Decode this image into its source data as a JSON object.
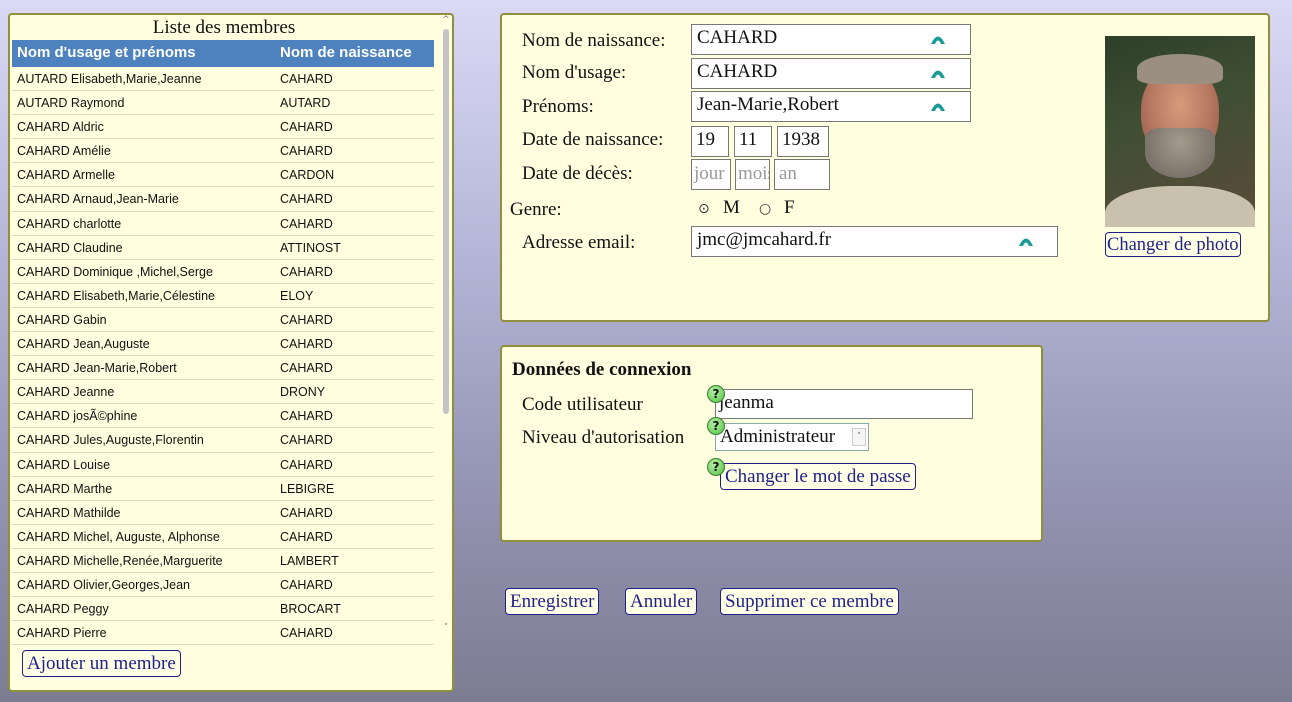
{
  "members_list": {
    "title": "Liste des membres",
    "columns": [
      "Nom d'usage et prénoms",
      "Nom de naissance"
    ],
    "rows": [
      [
        "AUTARD Elisabeth,Marie,Jeanne",
        "CAHARD"
      ],
      [
        "AUTARD Raymond",
        "AUTARD"
      ],
      [
        "CAHARD Aldric",
        "CAHARD"
      ],
      [
        "CAHARD Amélie",
        "CAHARD"
      ],
      [
        "CAHARD Armelle",
        "CARDON"
      ],
      [
        "CAHARD Arnaud,Jean-Marie",
        "CAHARD"
      ],
      [
        "CAHARD charlotte",
        "CAHARD"
      ],
      [
        "CAHARD Claudine",
        "ATTINOST"
      ],
      [
        "CAHARD Dominique ,Michel,Serge",
        "CAHARD"
      ],
      [
        "CAHARD Elisabeth,Marie,Célestine",
        "ELOY"
      ],
      [
        "CAHARD Gabin",
        "CAHARD"
      ],
      [
        "CAHARD Jean,Auguste",
        "CAHARD"
      ],
      [
        "CAHARD Jean-Marie,Robert",
        "CAHARD"
      ],
      [
        "CAHARD Jeanne",
        "DRONY"
      ],
      [
        "CAHARD josÃ©phine",
        "CAHARD"
      ],
      [
        "CAHARD Jules,Auguste,Florentin",
        "CAHARD"
      ],
      [
        "CAHARD Louise",
        "CAHARD"
      ],
      [
        "CAHARD Marthe",
        "LEBIGRE"
      ],
      [
        "CAHARD Mathilde",
        "CAHARD"
      ],
      [
        "CAHARD Michel, Auguste, Alphonse",
        "CAHARD"
      ],
      [
        "CAHARD Michelle,Renée,Marguerite",
        "LAMBERT"
      ],
      [
        "CAHARD Olivier,Georges,Jean",
        "CAHARD"
      ],
      [
        "CAHARD Peggy",
        "BROCART"
      ],
      [
        "CAHARD Pierre",
        "CAHARD"
      ]
    ],
    "add_button": "Ajouter un membre"
  },
  "identity": {
    "birth_name_label": "Nom de naissance:",
    "birth_name_value": "CAHARD",
    "usage_name_label": "Nom d'usage:",
    "usage_name_value": "CAHARD",
    "first_names_label": "Prénoms:",
    "first_names_value": "Jean-Marie,Robert",
    "birth_date_label": "Date de naissance:",
    "birth_day": "19",
    "birth_month": "11",
    "birth_year": "1938",
    "death_date_label": "Date de décès:",
    "death_day_placeholder": "jour",
    "death_month_placeholder": "mois",
    "death_year_placeholder": "an",
    "gender_label": "Genre:",
    "gender_m": "M",
    "gender_f": "F",
    "gender_selected": "M",
    "email_label": "Adresse email:",
    "email_value": "jmc@jmcahard.fr",
    "change_photo_button": "Changer de photo"
  },
  "connection": {
    "title": "Données de connexion",
    "user_code_label": "Code utilisateur",
    "user_code_value": "jeanma",
    "auth_level_label": "Niveau d'autorisation",
    "auth_level_value": "Administrateur",
    "change_password_button": "Changer le mot de passe",
    "help_glyph": "?"
  },
  "actions": {
    "save": "Enregistrer",
    "cancel": "Annuler",
    "delete": "Supprimer ce membre"
  },
  "icons": {
    "field_icon": "teal-arch-icon",
    "help_icon": "question-icon",
    "radio_checked": "radio-checked-icon",
    "radio_unchecked": "radio-unchecked-icon"
  },
  "colors": {
    "panel_bg": "#ffffe0",
    "panel_border": "#8f8f3c",
    "list_header_bg": "#4e82bf",
    "button_text": "#1f1f8a",
    "field_icon": "#1a9a96",
    "help_icon": "#6fcf5f"
  }
}
